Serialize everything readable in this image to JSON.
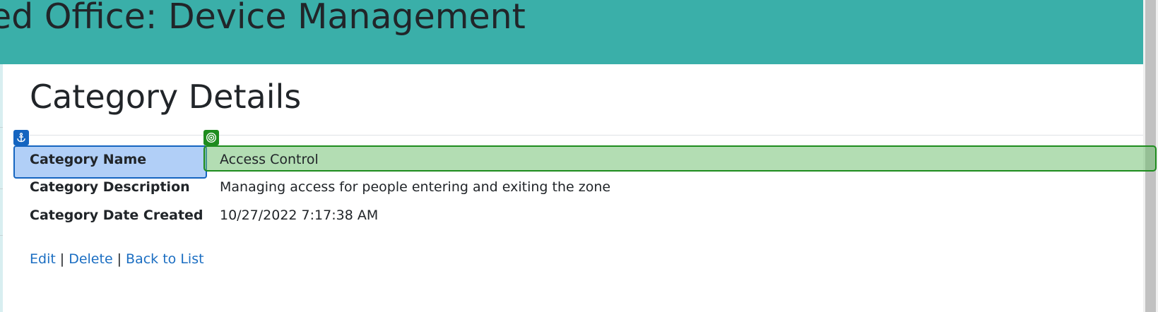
{
  "header": {
    "title": "ed Office: Device Management",
    "background_color": "#3aafa9"
  },
  "page": {
    "title": "Category Details"
  },
  "details": [
    {
      "term": "Category Name",
      "value": "Access Control"
    },
    {
      "term": "Category Description",
      "value": "Managing access for people entering and exiting the zone"
    },
    {
      "term": "Category Date Created",
      "value": "10/27/2022 7:17:38 AM"
    }
  ],
  "actions": {
    "edit": "Edit",
    "delete": "Delete",
    "back": "Back to List",
    "separator": "|"
  },
  "overlay": {
    "anchor_icon": "anchor-icon",
    "target_icon": "target-icon",
    "anchor_color": "#1565c0",
    "target_color": "#1e8c1e"
  }
}
